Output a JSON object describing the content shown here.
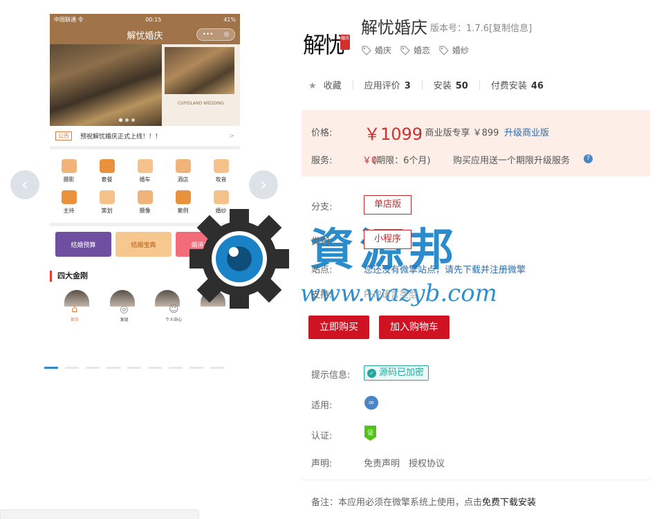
{
  "phone": {
    "status_left": "中国联通 令",
    "status_time": "00:15",
    "status_right": "41%",
    "nav_title": "解忧婚庆",
    "banner_caption": "CUPIDLAND WEDDING",
    "notice_tag": "公告",
    "notice_text": "预祝解忧婚庆正式上线！！！",
    "notice_arrow": ">",
    "grid": [
      "摄影",
      "套餐",
      "婚车",
      "酒店",
      "攻音",
      "主持",
      "策划",
      "摄像",
      "案例",
      "婚纱"
    ],
    "cards": [
      "结婚预算",
      "结婚宝典",
      "婚道吉日"
    ],
    "section_title": "四大金刚",
    "tabs": [
      "首页",
      "发现",
      "个人中心"
    ]
  },
  "carousel": {
    "prev": "‹",
    "next": "›"
  },
  "watermark": {
    "text": "資源邦",
    "url": "www.wazyb.com"
  },
  "app": {
    "logo_text": "解忧",
    "logo_seal": "婚庆",
    "title": "解忧婚庆",
    "version": "版本号：1.7.6[复制信息]",
    "tags": [
      "婚庆",
      "婚恋",
      "婚纱"
    ]
  },
  "stats": {
    "favorite": "收藏",
    "rating_label": "应用评价",
    "rating_value": "3",
    "install_label": "安装",
    "install_value": "50",
    "paid_label": "付费安装",
    "paid_value": "46"
  },
  "pricing": {
    "price_label": "价格:",
    "price": "￥1099",
    "commercial": "| 商业版专享 ￥899",
    "upgrade_link": "升级商业版",
    "service_label": "服务:",
    "service_price": "￥0",
    "service_period": "(期限：6个月)",
    "service_note": "购买应用送一个期限升级服务",
    "help": "?"
  },
  "options": {
    "branch_label": "分支:",
    "branch_value": "单店版",
    "category_label": "类别:",
    "category_value": "小程序",
    "site_label": "站点:",
    "site_text": "您还没有微擎站点，请先下载并注册微擎",
    "support_label": "支持:",
    "support_text": "PHP语言类型"
  },
  "actions": {
    "buy": "立即购买",
    "cart": "加入购物车"
  },
  "info": {
    "tip_label": "提示信息:",
    "encrypted": "源码已加密",
    "apply_label": "适用:",
    "cert_label": "认证:",
    "cert_icon": "证",
    "decl_label": "声明:",
    "disclaimer": "免责声明",
    "license": "授权协议",
    "remark_prefix": "备注：本应用必须在微擎系统上使用，点击",
    "remark_link": "免费下载安装"
  },
  "colors": {
    "accent_red": "#cf1322",
    "phone_brand": "#a07348",
    "link_blue": "#2b6cb0",
    "watermark_blue": "#1a83c8"
  }
}
